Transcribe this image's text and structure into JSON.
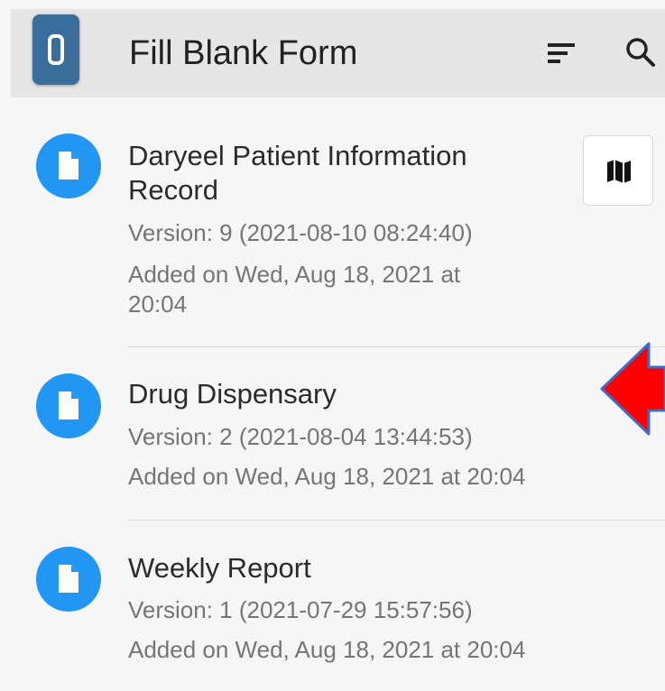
{
  "app_bar": {
    "title": "Fill Blank Form",
    "logo_icon": "app-logo-icon",
    "sort_icon": "sort-icon",
    "search_icon": "search-icon",
    "color": "#e6e6e6"
  },
  "forms": [
    {
      "title": "Daryeel Patient Information Record",
      "version": "Version: 9 (2021-08-10 08:24:40)",
      "added": "Added on Wed, Aug 18, 2021 at 20:04",
      "icon": "form-document-icon",
      "has_map_button": true
    },
    {
      "title": "Drug Dispensary",
      "version": "Version: 2 (2021-08-04 13:44:53)",
      "added": "Added on Wed, Aug 18, 2021 at 20:04",
      "icon": "form-document-icon",
      "has_map_button": false
    },
    {
      "title": "Weekly Report",
      "version": "Version: 1 (2021-07-29 15:57:56)",
      "added": "Added on Wed, Aug 18, 2021 at 20:04",
      "icon": "form-document-icon",
      "has_map_button": false
    }
  ],
  "map_button_icon": "map-icon",
  "annotation_arrow_icon": "red-arrow-icon",
  "colors": {
    "accent": "#2196f3",
    "arrow_fill": "#ff0000",
    "arrow_stroke": "#3b6ec9"
  }
}
